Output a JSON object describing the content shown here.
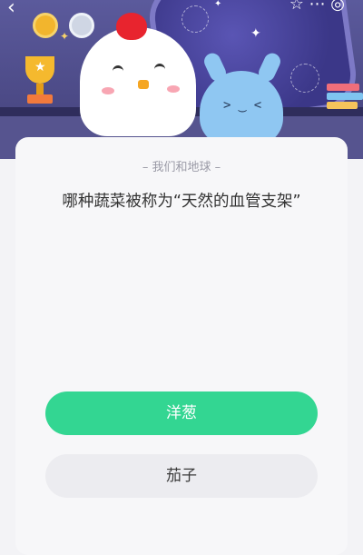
{
  "quiz": {
    "subtitle": "我们和地球",
    "question": "哪种蔬菜被称为“天然的血管支架”",
    "options": [
      "洋葱",
      "茄子"
    ]
  },
  "colors": {
    "primary_option": "#33d692",
    "secondary_option": "#ececf0",
    "banner": "#4a4884"
  },
  "icons": {
    "back": "back-arrow-icon",
    "favorite": "star-icon",
    "more": "more-icon"
  }
}
